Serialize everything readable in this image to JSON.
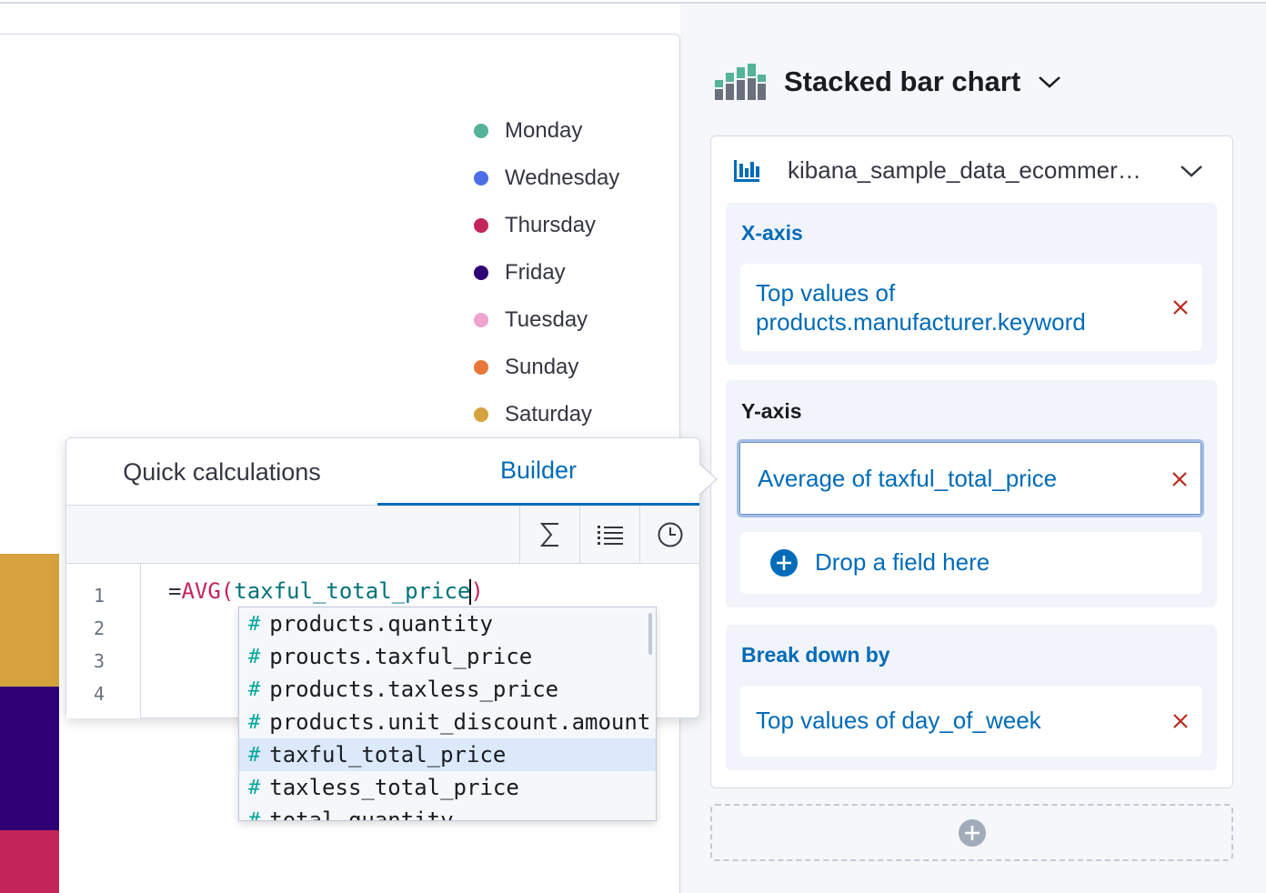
{
  "legend": {
    "items": [
      {
        "label": "Monday",
        "color": "#54b399"
      },
      {
        "label": "Wednesday",
        "color": "#4c6fe9"
      },
      {
        "label": "Thursday",
        "color": "#c3255b"
      },
      {
        "label": "Friday",
        "color": "#2f0075"
      },
      {
        "label": "Tuesday",
        "color": "#f0a3cf"
      },
      {
        "label": "Sunday",
        "color": "#e7783a"
      },
      {
        "label": "Saturday",
        "color": "#d6a23e"
      }
    ]
  },
  "chart_type": {
    "title": "Stacked bar chart",
    "icon": "stacked-bar-chart-icon"
  },
  "config": {
    "index_pattern": "kibana_sample_data_ecommer…",
    "x_axis": {
      "title": "X-axis",
      "dimension": "Top values of products.manufacturer.keyword"
    },
    "y_axis": {
      "title": "Y-axis",
      "dimension": "Average of taxful_total_price",
      "drop_placeholder": "Drop a field here"
    },
    "breakdown": {
      "title": "Break down by",
      "dimension": "Top values of day_of_week"
    }
  },
  "popover": {
    "tabs": [
      "Quick calculations",
      "Builder"
    ],
    "active_tab": "Builder",
    "toolbar_icons": [
      "sigma-icon",
      "list-icon",
      "clock-icon"
    ],
    "line_numbers": [
      "1",
      "2",
      "3",
      "4"
    ],
    "code": {
      "eq": "=",
      "fn": "AVG(",
      "arg": "taxful_total_price",
      "close": ")"
    }
  },
  "suggestions": {
    "items": [
      "products.quantity",
      "proucts.taxful_price",
      "products.taxless_price",
      "products.unit_discount.amount",
      "taxful_total_price",
      "taxless_total_price",
      "total_quantity"
    ],
    "selected": "taxful_total_price"
  },
  "colors": {
    "accent": "#006bb8",
    "danger": "#bd271e",
    "bar_saturday": "#d6a23e",
    "bar_friday": "#2f0075",
    "bar_thursday": "#c3255b"
  }
}
